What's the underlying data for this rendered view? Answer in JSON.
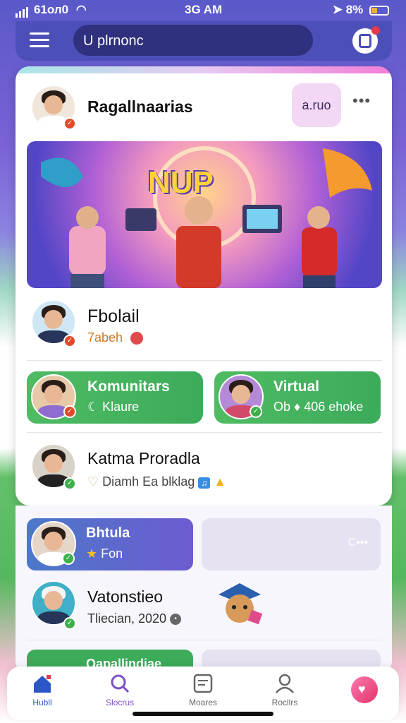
{
  "status_bar": {
    "carrier": "61ол0",
    "time": "3G AM",
    "battery": "8%"
  },
  "top_nav": {
    "search_text": "U plrnonc"
  },
  "post": {
    "author": "Ragallnaarias",
    "chip_label": "a.ruo",
    "more_label": "•••",
    "banner_text": "NUP"
  },
  "items": [
    {
      "name": "Fbolail",
      "sub": "7abeh"
    },
    {
      "name": "Katma Proradla",
      "sub": "Diamh Ea blklag"
    }
  ],
  "pills": [
    {
      "title": "Komunitars",
      "sub": "Klaure"
    },
    {
      "title": "Virtual",
      "sub": "Ob ♦ 406 ehoke"
    }
  ],
  "lower": {
    "pill_title": "Bhtula",
    "pill_sub": "Fon",
    "ghost_text": "C•••",
    "item_name": "Vatonstieo",
    "item_sub": "Tliecian, 2020",
    "peek_title": "Qapallindiae"
  },
  "bottom_nav": [
    {
      "label": "Hubll"
    },
    {
      "label": "Slocrus"
    },
    {
      "label": "Moares"
    },
    {
      "label": "Rocllrs"
    }
  ],
  "colors": {
    "accent": "#4d4fb8",
    "green": "#4fbb63",
    "purple": "#7a4fc8"
  }
}
